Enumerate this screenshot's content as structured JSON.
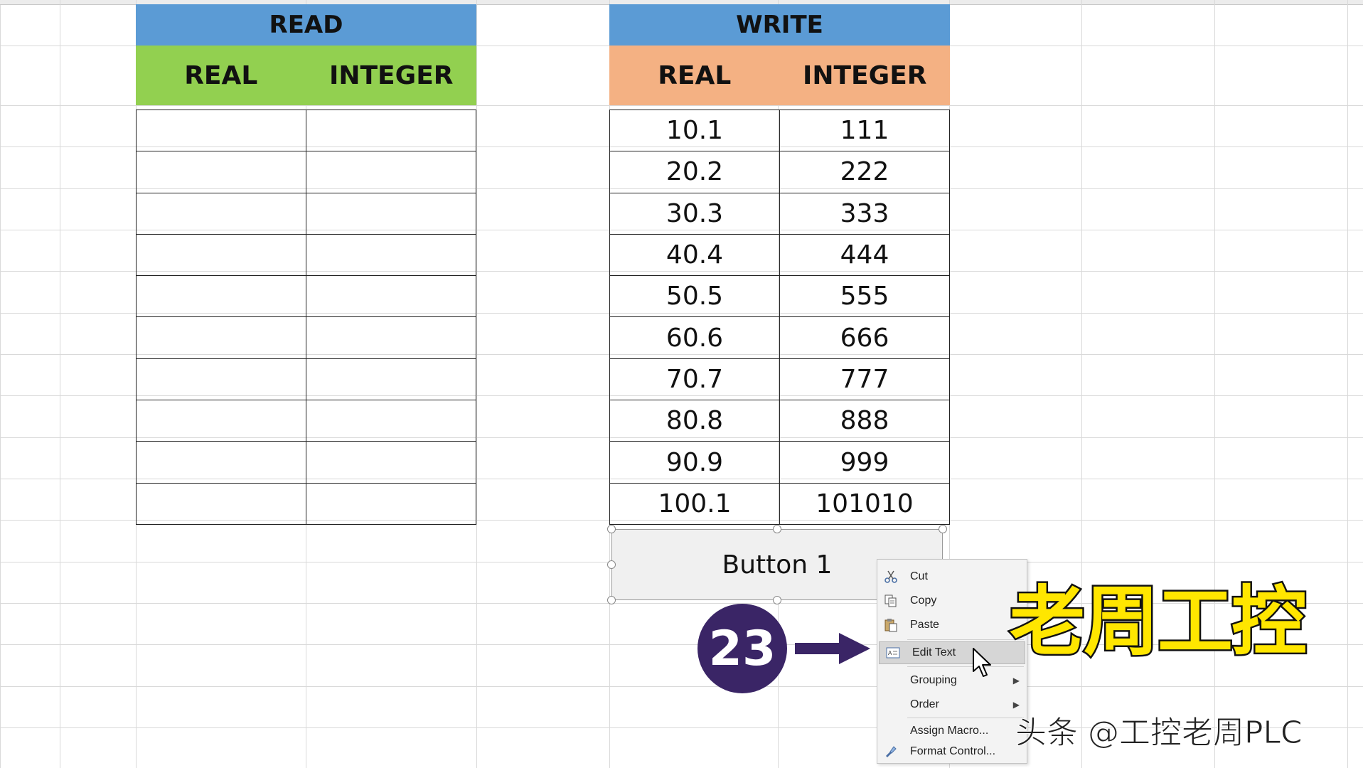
{
  "read_table": {
    "title": "READ",
    "headers": [
      "REAL",
      "INTEGER"
    ],
    "rows": [
      [
        "",
        ""
      ],
      [
        "",
        ""
      ],
      [
        "",
        ""
      ],
      [
        "",
        ""
      ],
      [
        "",
        ""
      ],
      [
        "",
        ""
      ],
      [
        "",
        ""
      ],
      [
        "",
        ""
      ],
      [
        "",
        ""
      ],
      [
        "",
        ""
      ]
    ]
  },
  "write_table": {
    "title": "WRITE",
    "headers": [
      "REAL",
      "INTEGER"
    ],
    "rows": [
      [
        "10.1",
        "111"
      ],
      [
        "20.2",
        "222"
      ],
      [
        "30.3",
        "333"
      ],
      [
        "40.4",
        "444"
      ],
      [
        "50.5",
        "555"
      ],
      [
        "60.6",
        "666"
      ],
      [
        "70.7",
        "777"
      ],
      [
        "80.8",
        "888"
      ],
      [
        "90.9",
        "999"
      ],
      [
        "100.1",
        "101010"
      ]
    ]
  },
  "button": {
    "label": "Button 1"
  },
  "context_menu": {
    "items": [
      {
        "label": "Cut",
        "icon": "scissors-icon"
      },
      {
        "label": "Copy",
        "icon": "copy-icon"
      },
      {
        "label": "Paste",
        "icon": "paste-icon"
      },
      {
        "label": "Edit Text",
        "icon": "edit-text-icon",
        "highlighted": true
      },
      {
        "label": "Grouping",
        "icon": "",
        "submenu": true
      },
      {
        "label": "Order",
        "icon": "",
        "submenu": true
      },
      {
        "label": "Assign Macro...",
        "icon": ""
      },
      {
        "label": "Format Control...",
        "icon": "format-control-icon"
      }
    ]
  },
  "step_badge": {
    "number": "23"
  },
  "watermark": {
    "brand": "老周工控",
    "attribution": "头条 @工控老周PLC"
  },
  "colors": {
    "read_title_bg": "#5b9bd5",
    "read_header_bg": "#92d050",
    "write_title_bg": "#5b9bd5",
    "write_header_bg": "#f4b183",
    "badge_bg": "#3a2566",
    "brand_text": "#ffe600"
  }
}
